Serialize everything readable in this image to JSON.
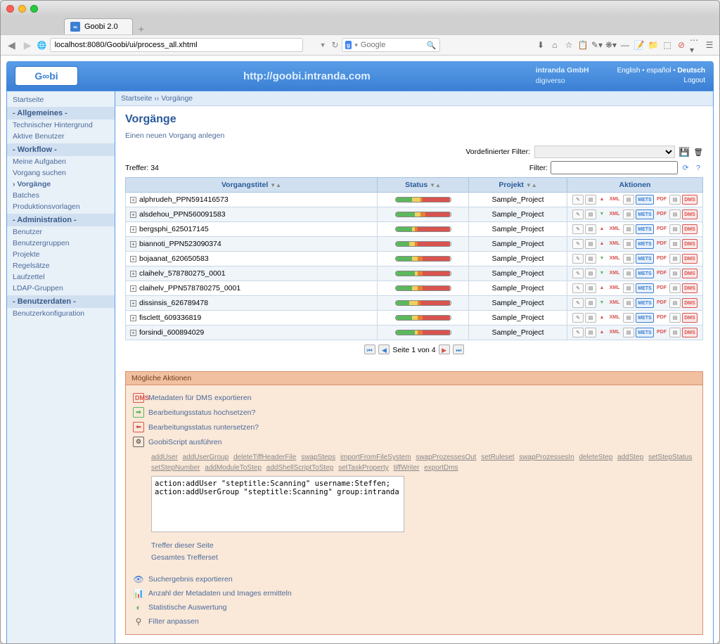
{
  "browser": {
    "tab_title": "Goobi 2.0",
    "url": "localhost:8080/Goobi/ui/process_all.xhtml",
    "search_placeholder": "Google"
  },
  "header": {
    "logo_text": "G∞bi",
    "center_url": "http://goobi.intranda.com",
    "company": "intranda GmbH",
    "subtitle": "digiverso",
    "languages": [
      "English",
      "español",
      "Deutsch"
    ],
    "active_language": "Deutsch",
    "logout": "Logout"
  },
  "sidebar": {
    "home": "Startseite",
    "sections": [
      {
        "title": "- Allgemeines -",
        "items": [
          "Technischer Hintergrund",
          "Aktive Benutzer"
        ]
      },
      {
        "title": "- Workflow -",
        "items": [
          "Meine Aufgaben",
          "Vorgang suchen",
          "Vorgänge",
          "Batches",
          "Produktionsvorlagen"
        ],
        "active": "Vorgänge"
      },
      {
        "title": "- Administration -",
        "items": [
          "Benutzer",
          "Benutzergruppen",
          "Projekte",
          "Regelsätze",
          "Laufzettel",
          "LDAP-Gruppen"
        ]
      },
      {
        "title": "- Benutzerdaten -",
        "items": [
          "Benutzerkonfiguration"
        ]
      }
    ]
  },
  "breadcrumb": {
    "parts": [
      "Startseite",
      "Vorgänge"
    ],
    "sep": "››"
  },
  "page": {
    "title": "Vorgänge",
    "new_link": "Einen neuen Vorgang anlegen",
    "predefined_filter_label": "Vordefinierter Filter:",
    "filter_label": "Filter:",
    "hits_label": "Treffer:",
    "hits_count": "34"
  },
  "table": {
    "columns": {
      "title": "Vorgangstitel",
      "status": "Status",
      "project": "Projekt",
      "actions": "Aktionen"
    },
    "action_labels": {
      "xml": "XML",
      "mets": "METS",
      "pdf": "PDF",
      "dms": "DMS"
    },
    "rows": [
      {
        "title": "alphrudeh_PPN591416573",
        "project": "Sample_Project",
        "status": [
          30,
          15,
          5,
          50
        ],
        "up": true
      },
      {
        "title": "alsdehou_PPN560091583",
        "project": "Sample_Project",
        "status": [
          35,
          10,
          10,
          45
        ],
        "up": false
      },
      {
        "title": "bergsphi_625017145",
        "project": "Sample_Project",
        "status": [
          30,
          5,
          5,
          60
        ],
        "up": true
      },
      {
        "title": "biannoti_PPN523090374",
        "project": "Sample_Project",
        "status": [
          25,
          10,
          5,
          60
        ],
        "up": true
      },
      {
        "title": "bojaanat_620650583",
        "project": "Sample_Project",
        "status": [
          30,
          10,
          10,
          50
        ],
        "up": false
      },
      {
        "title": "claihelv_578780275_0001",
        "project": "Sample_Project",
        "status": [
          35,
          5,
          10,
          50
        ],
        "up": false
      },
      {
        "title": "claihelv_PPN578780275_0001",
        "project": "Sample_Project",
        "status": [
          30,
          10,
          10,
          50
        ],
        "up": true
      },
      {
        "title": "dissinsis_626789478",
        "project": "Sample_Project",
        "status": [
          25,
          15,
          5,
          55
        ],
        "up": false
      },
      {
        "title": "fisclett_609336819",
        "project": "Sample_Project",
        "status": [
          30,
          10,
          10,
          50
        ],
        "up": true
      },
      {
        "title": "forsindi_600894029",
        "project": "Sample_Project",
        "status": [
          35,
          5,
          10,
          50
        ],
        "up": true
      }
    ]
  },
  "pager": {
    "text": "Seite 1 von 4"
  },
  "actions_panel": {
    "header": "Mögliche Aktionen",
    "rows": [
      {
        "icon": "DMS",
        "label": "Metadaten für DMS exportieren",
        "color": "#d9534f"
      },
      {
        "icon": "➡",
        "label": "Bearbeitungsstatus hochsetzen?",
        "color": "#5cb85c"
      },
      {
        "icon": "⬅",
        "label": "Bearbeitungsstatus runtersetzen?",
        "color": "#d9534f"
      },
      {
        "icon": "⚙",
        "label": "GoobiScript ausführen",
        "color": "#666"
      }
    ],
    "script_links": [
      "addUser",
      "addUserGroup",
      "deleteTiffHeaderFile",
      "swapSteps",
      "importFromFileSystem",
      "swapProzessesOut",
      "setRuleset",
      "swapProzessesIn",
      "deleteStep",
      "addStep",
      "setStepStatus",
      "setStepNumber",
      "addModuleToStep",
      "addShellScriptToStep",
      "setTaskProperty",
      "tiffWriter",
      "exportDms"
    ],
    "script_text": "action:addUser \"steptitle:Scanning\" username:Steffen;\naction:addUserGroup \"steptitle:Scanning\" group:intranda",
    "sub_links": [
      "Treffer dieser Seite",
      "Gesamtes Trefferset"
    ],
    "bottom_actions": [
      {
        "icon": "👁",
        "label": "Suchergebnis exportieren",
        "color": "#3a7fd4"
      },
      {
        "icon": "📊",
        "label": "Anzahl der Metadaten und Images ermitteln",
        "color": "#e88030"
      },
      {
        "icon": "◐",
        "label": "Statistische Auswertung",
        "color": "#5cb85c"
      },
      {
        "icon": "⚲",
        "label": "Filter anpassen",
        "color": "#666"
      }
    ]
  }
}
